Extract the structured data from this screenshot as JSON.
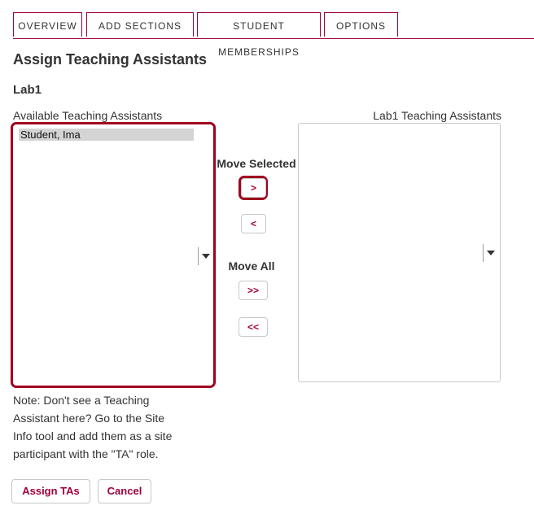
{
  "tabs": [
    "OVERVIEW",
    "ADD SECTIONS",
    "STUDENT MEMBERSHIPS",
    "OPTIONS"
  ],
  "page_title": "Assign Teaching Assistants",
  "section_name": "Lab1",
  "available": {
    "label": "Available Teaching Assistants",
    "items": [
      "Student, Ima"
    ]
  },
  "assigned": {
    "label": "Lab1 Teaching Assistants",
    "items": []
  },
  "controls": {
    "move_selected_label": "Move Selected",
    "move_all_label": "Move All",
    "add_selected": ">",
    "remove_selected": "<",
    "add_all": ">>",
    "remove_all": "<<"
  },
  "note": "Note: Don't see a Teaching Assistant here? Go to the Site Info tool and add them as a site participant with the \"TA\" role.",
  "actions": {
    "assign": "Assign TAs",
    "cancel": "Cancel"
  },
  "colors": {
    "accent": "#a0003c",
    "highlight": "#a0001e",
    "selected_item": "#d4d4d4"
  }
}
